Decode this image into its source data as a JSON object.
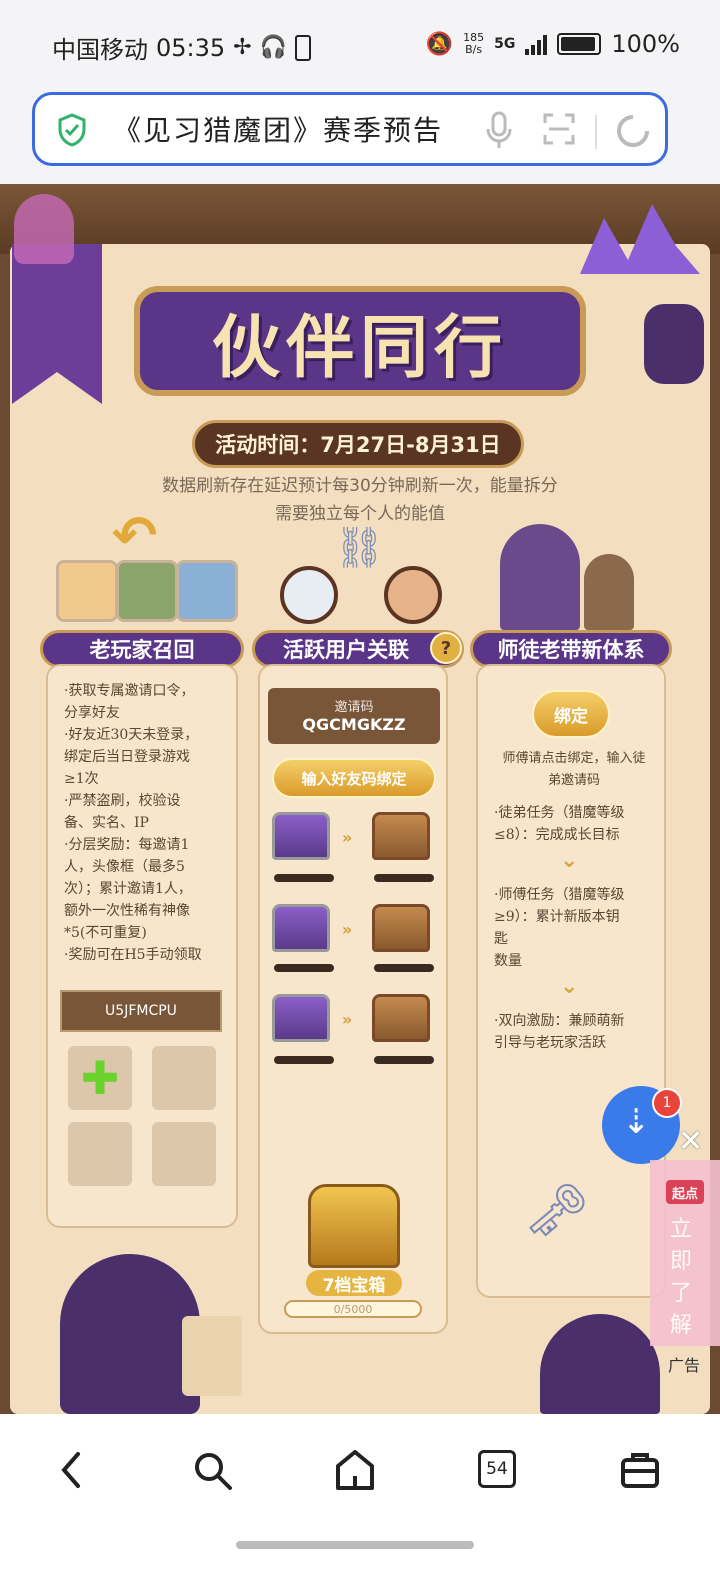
{
  "status_bar": {
    "carrier": "中国移动",
    "time": "05:35",
    "net_speed_value": "185",
    "net_speed_unit": "B/s",
    "network": "5G",
    "battery": "100%"
  },
  "address_bar": {
    "title": "《见习猎魔团》赛季预告"
  },
  "page": {
    "main_title": "伙伴同行",
    "event_time": "活动时间：7月27日-8月31日",
    "notice": "数据刷新存在延迟预计每30分钟刷新一次，能量拆分需要独立每个人的能值",
    "columns": {
      "recall": {
        "header": "老玩家召回",
        "lines": [
          "·获取专属邀请口令，",
          "分享好友",
          "·好友近30天未登录，",
          "绑定后当日登录游戏",
          "≥1次",
          "·严禁盗刷，校验设",
          "备、实名、IP",
          "·分层奖励：每邀请1",
          "人，头像框（最多5",
          "次）；累计邀请1人，",
          "额外一次性稀有神像",
          "*5(不可重复)",
          "·奖励可在H5手动领取"
        ],
        "code": "U5JFMCPU"
      },
      "active": {
        "header": "活跃用户关联",
        "help": "?",
        "code_label": "邀请码",
        "code": "QGCMGKZZ",
        "bind_button": "输入好友码绑定",
        "chest_title": "7档宝箱",
        "chest_progress_text": "0/5000",
        "chest_progress": 0
      },
      "mentor": {
        "header": "师徒老带新体系",
        "bind_button": "绑定",
        "intro": [
          "师傅请点击绑定，输入徒",
          "弟邀请码"
        ],
        "task1": [
          "·徒弟任务（猎魔等级",
          "≤8）：完成成长目标"
        ],
        "task2": [
          "·师傅任务（猎魔等级",
          "≥9）：累计新版本钥",
          "匙",
          "数量"
        ],
        "task3": [
          "·双向激励：兼顾萌新",
          "引导与老玩家活跃"
        ]
      }
    }
  },
  "floating": {
    "badge": "1",
    "ad_tag": "起点",
    "ad_text": [
      "立",
      "即",
      "了",
      "解"
    ],
    "ad_label": "广告"
  },
  "bottom_nav": {
    "tabs_count": "54"
  },
  "colors": {
    "accent": "#3b6be0",
    "purple": "#5a3588",
    "gold": "#c89b57"
  }
}
